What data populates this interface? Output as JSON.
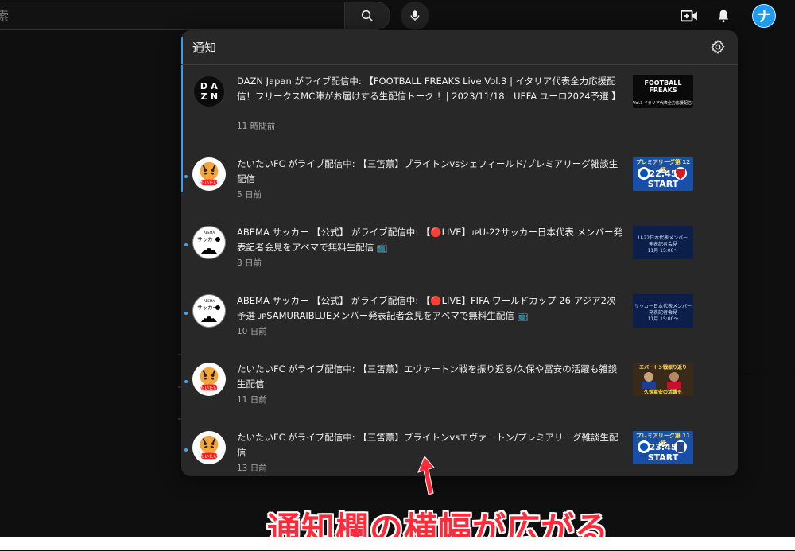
{
  "header": {
    "search_placeholder": "索",
    "search_icon": "search-icon",
    "mic_icon": "mic-icon",
    "create_icon": "video-create-icon",
    "bell_icon": "bell-icon",
    "avatar_letter": "ナ"
  },
  "notifications_panel": {
    "title": "通知",
    "settings_icon": "gear-icon",
    "items": [
      {
        "channel": "DAZN Japan",
        "avatar": "dazn-logo",
        "text": "DAZN Japan がライブ配信中: 【FOOTBALL FREAKS Live Vol.3 | イタリア代表全力応援配信！フリークスMC陣がお届けする生配信トーク ！| 2023/11/18　UEFA ユーロ2024予選 】",
        "time": "11 時間前",
        "unread": false,
        "thumb": {
          "line1": "FOOTBALL",
          "line2": "FREAKS",
          "caption": "Vol.3 イタリア代表全力応援配信!"
        }
      },
      {
        "channel": "たいたいFC",
        "avatar": "taitai-tiger",
        "text": "たいたいFC がライブ配信中: 【三笘薫】ブライトンvsシェフィールド/プレミアリーグ雑談生配信",
        "time": "5 日前",
        "unread": true,
        "thumb": {
          "top": "プレミアリーグ第 12 節",
          "vs": "VS",
          "start": "22:45 START"
        }
      },
      {
        "channel": "ABEMA サッカー 【公式】",
        "avatar": "abema-soccer",
        "text": "ABEMA サッカー 【公式】 がライブ配信中: 【🔴LIVE】ᴊᴘU-22サッカー日本代表 メンバー発表記者会見をアベマで無料生配信 📺",
        "time": "8 日前",
        "unread": true,
        "thumb": {
          "line1": "U-22日本代表メンバー",
          "line2": "発表記者会見",
          "line3": "11月 15:00〜"
        }
      },
      {
        "channel": "ABEMA サッカー 【公式】",
        "avatar": "abema-soccer",
        "text": "ABEMA サッカー 【公式】 がライブ配信中: 【🔴LIVE】FIFA ワールドカップ 26 アジア2次予選 ᴊᴘSAMURAIBLUEメンバー発表記者会見をアベマで無料生配信 📺",
        "time": "10 日前",
        "unread": true,
        "thumb": {
          "line1": "サッカー日本代表メンバー",
          "line2": "発表記者会見",
          "line3": "11月 15:00〜"
        }
      },
      {
        "channel": "たいたいFC",
        "avatar": "taitai-tiger",
        "text": "たいたいFC がライブ配信中: 【三笘薫】エヴァートン戦を振り返る/久保や冨安の活躍も雑談生配信",
        "time": "11 日前",
        "unread": true,
        "thumb": {
          "top": "エバートン戦振り返り",
          "bottom": "久保冨安の活躍も"
        }
      },
      {
        "channel": "たいたいFC",
        "avatar": "taitai-tiger",
        "text": "たいたいFC がライブ配信中: 【三笘薫】ブライトンvsエヴァートン/プレミアリーグ雑談生配信",
        "time": "13 日前",
        "unread": true,
        "thumb": {
          "top": "プレミアリーグ第 11 節",
          "vs": "VS",
          "start": "23:45 START"
        }
      }
    ]
  },
  "annotation": {
    "caption": "通知欄の横幅が広がる",
    "color": "#ff2b3a"
  }
}
